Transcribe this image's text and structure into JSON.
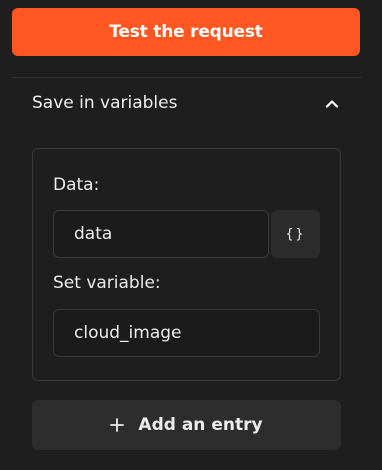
{
  "primary": {
    "test_label": "Test the request",
    "color": "#ff5722"
  },
  "section": {
    "title": "Save in variables",
    "expanded": true,
    "toggle_icon": "chevron-up-icon"
  },
  "entry": {
    "data_label": "Data:",
    "data_value": "data",
    "json_button_glyph": "{}",
    "set_variable_label": "Set variable:",
    "set_variable_value": "cloud_image"
  },
  "add": {
    "icon": "plus-icon",
    "label": "Add an entry"
  }
}
